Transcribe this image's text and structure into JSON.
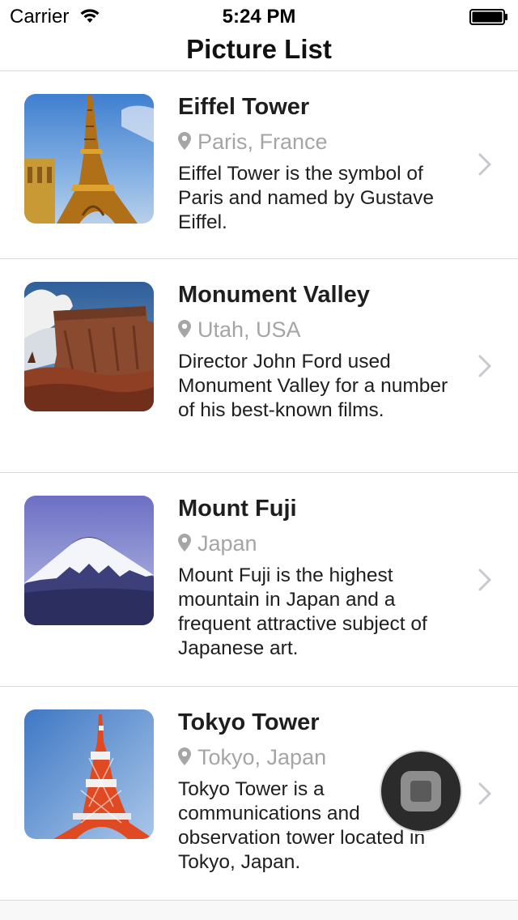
{
  "status_bar": {
    "carrier": "Carrier",
    "time": "5:24 PM",
    "wifi_icon": "wifi-icon",
    "battery_icon": "battery-full-icon"
  },
  "nav": {
    "title": "Picture List"
  },
  "items": [
    {
      "title": "Eiffel Tower",
      "location": "Paris, France",
      "description": "Eiffel Tower is the symbol of Paris and named by Gustave Eiffel.",
      "thumbnail_icon": "eiffel-tower-photo"
    },
    {
      "title": "Monument Valley",
      "location": "Utah, USA",
      "description": "Director John Ford used Monument Valley for a number of his best-known films.",
      "thumbnail_icon": "monument-valley-photo"
    },
    {
      "title": "Mount Fuji",
      "location": "Japan",
      "description": "Mount Fuji is the highest mountain in Japan and a frequent attractive subject of Japanese art.",
      "thumbnail_icon": "mount-fuji-photo"
    },
    {
      "title": "Tokyo Tower",
      "location": "Tokyo, Japan",
      "description": "Tokyo Tower is a communications and observation tower located in Tokyo, Japan.",
      "thumbnail_icon": "tokyo-tower-photo"
    }
  ],
  "colors": {
    "location_text": "#a5a5a5",
    "separator": "#dadada",
    "chevron": "#c7c7cc"
  }
}
